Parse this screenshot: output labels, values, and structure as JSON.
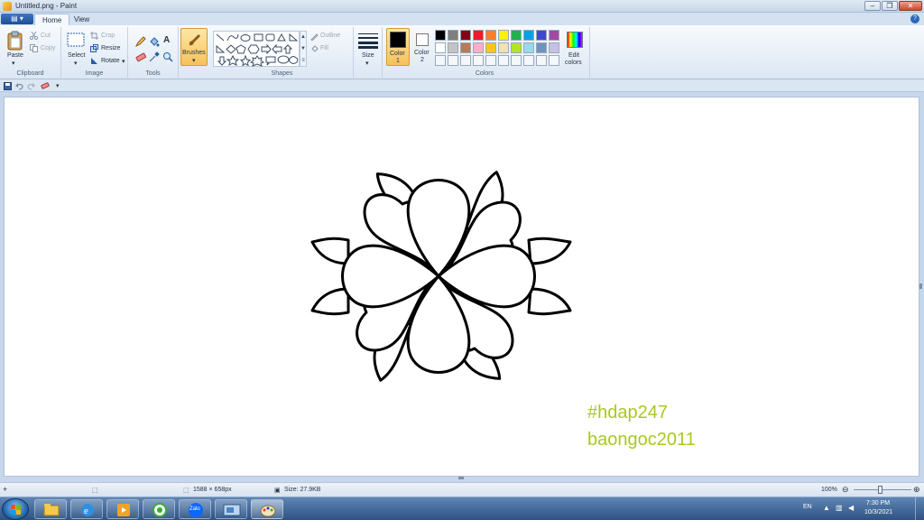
{
  "window": {
    "title": "Untitled.png - Paint",
    "controls": [
      "–",
      "❐",
      "✕"
    ]
  },
  "tabs": {
    "app_menu": "▤ ▾",
    "items": [
      "Home",
      "View"
    ],
    "help": "?"
  },
  "ribbon": {
    "clipboard": {
      "paste": "Paste",
      "cut": "Cut",
      "copy": "Copy",
      "label": "Clipboard"
    },
    "image": {
      "select": "Select",
      "crop": "Crop",
      "resize": "Resize",
      "rotate": "Rotate",
      "label": "Image"
    },
    "tools": {
      "label": "Tools"
    },
    "brushes": {
      "label": "Brushes"
    },
    "shapes": {
      "outline": "Outline",
      "fill": "Fill",
      "label": "Shapes"
    },
    "size": {
      "label": "Size"
    },
    "color1": {
      "label_a": "Color",
      "label_b": "1",
      "value": "#000000"
    },
    "color2": {
      "label_a": "Color",
      "label_b": "2",
      "value": "#ffffff"
    },
    "colors": {
      "label": "Colors",
      "row1": [
        "#000000",
        "#7f7f7f",
        "#880015",
        "#ed1c24",
        "#ff7f27",
        "#fff200",
        "#22b14c",
        "#00a2e8",
        "#3f48cc",
        "#a349a4"
      ],
      "row2": [
        "#ffffff",
        "#c3c3c3",
        "#b97a57",
        "#ffaec9",
        "#ffc90e",
        "#efe4b0",
        "#b5e61d",
        "#99d9ea",
        "#7092be",
        "#c8bfe7"
      ],
      "row3_blank": 10
    },
    "edit_colors": {
      "label_a": "Edit",
      "label_b": "colors"
    }
  },
  "canvas": {
    "watermark_line1": "#hdap247",
    "watermark_line2": "baongoc2011",
    "watermark_color": "#a8c920"
  },
  "statusbar": {
    "dimensions": "1588 × 658px",
    "size": "Size: 27.9KB",
    "zoom": "100%"
  },
  "taskbar": {
    "apps": [
      "file-explorer-icon",
      "internet-explorer-icon",
      "media-player-icon",
      "coccoc-browser-icon",
      "zalo-icon",
      "screenshot-icon",
      "paint-icon"
    ],
    "zalo_label": "Zalo",
    "language": "EN",
    "time": "7:30 PM",
    "date": "10/3/2021"
  }
}
